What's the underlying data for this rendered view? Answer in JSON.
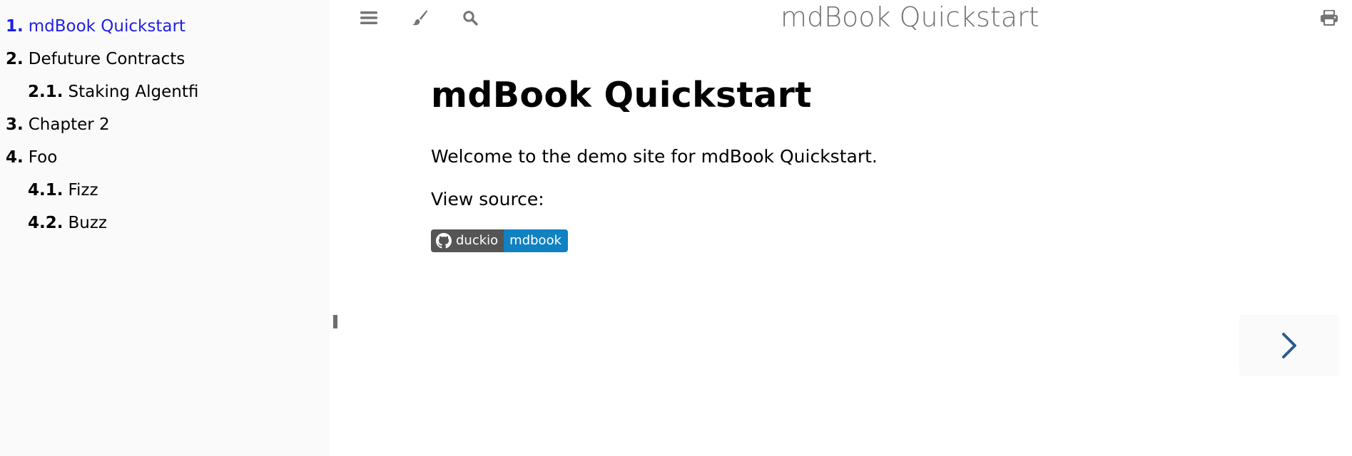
{
  "sidebar": {
    "items": [
      {
        "num": "1.",
        "label": "mdBook Quickstart",
        "level": 1,
        "active": true
      },
      {
        "num": "2.",
        "label": "Defuture Contracts",
        "level": 1,
        "active": false
      },
      {
        "num": "2.1.",
        "label": "Staking Algentfi",
        "level": 2,
        "active": false
      },
      {
        "num": "3.",
        "label": "Chapter 2",
        "level": 1,
        "active": false
      },
      {
        "num": "4.",
        "label": "Foo",
        "level": 1,
        "active": false
      },
      {
        "num": "4.1.",
        "label": "Fizz",
        "level": 2,
        "active": false
      },
      {
        "num": "4.2.",
        "label": "Buzz",
        "level": 2,
        "active": false
      }
    ]
  },
  "menu_bar": {
    "title": "mdBook Quickstart",
    "icons": [
      "hamburger-icon",
      "paintbrush-icon",
      "search-icon",
      "print-icon"
    ]
  },
  "content": {
    "title": "mdBook Quickstart",
    "paragraph_1": "Welcome to the demo site for mdBook Quickstart.",
    "paragraph_2": "View source:",
    "badge": {
      "left": "duckio",
      "right": "mdbook",
      "icon": "github-icon"
    }
  },
  "navigation": {
    "next_icon": "chevron-right-icon"
  },
  "colors": {
    "sidebar_bg": "#fafafa",
    "active_link": "#1f1fe6",
    "icon_gray": "#747474",
    "badge_left": "#555555",
    "badge_right": "#1081c1",
    "nav_arrow": "#2b5c8a"
  }
}
